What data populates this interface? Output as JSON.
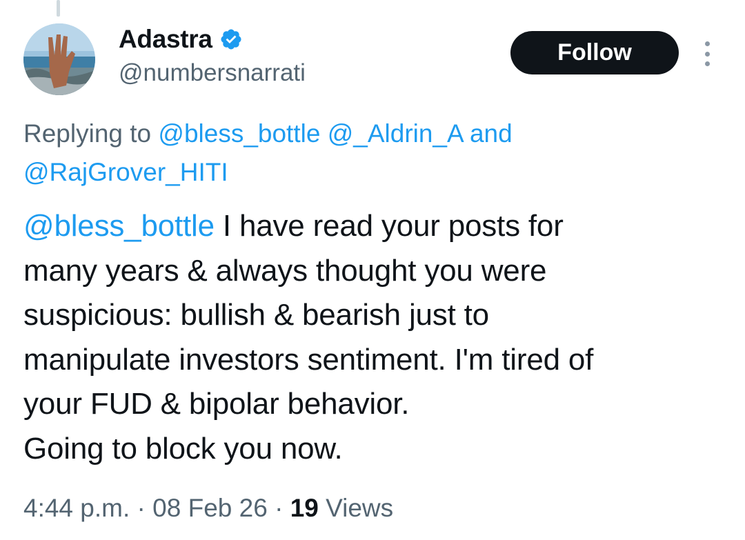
{
  "author": {
    "display_name": "Adastra",
    "handle": "@numbersnarrati",
    "verified_icon": "verified-badge-icon",
    "avatar_icon": "avatar-hand-beach-photo"
  },
  "follow_button": {
    "label": "Follow"
  },
  "more_menu_icon": "vertical-ellipsis-icon",
  "replying_to": {
    "prefix": "Replying to",
    "mentions": [
      "@bless_bottle",
      "@_Aldrin_A"
    ],
    "conjunction": "and",
    "last_mention": "@RajGrover_HITI"
  },
  "tweet": {
    "mention": "@bless_bottle",
    "line1": " I have read your posts for",
    "line2": "many years & always thought you were",
    "line3": "suspicious: bullish & bearish just to",
    "line4": "manipulate investors sentiment. I'm tired of",
    "line5": "your FUD & bipolar behavior.",
    "line6": "Going to block you now."
  },
  "meta": {
    "time": "4:44 p.m.",
    "separator": "·",
    "date": "08 Feb 26",
    "views_count": "19",
    "views_label": "Views"
  },
  "colors": {
    "link": "#1d9bf0",
    "secondary_text": "#536471",
    "primary_text": "#0f1419",
    "button_bg": "#0f1419"
  }
}
